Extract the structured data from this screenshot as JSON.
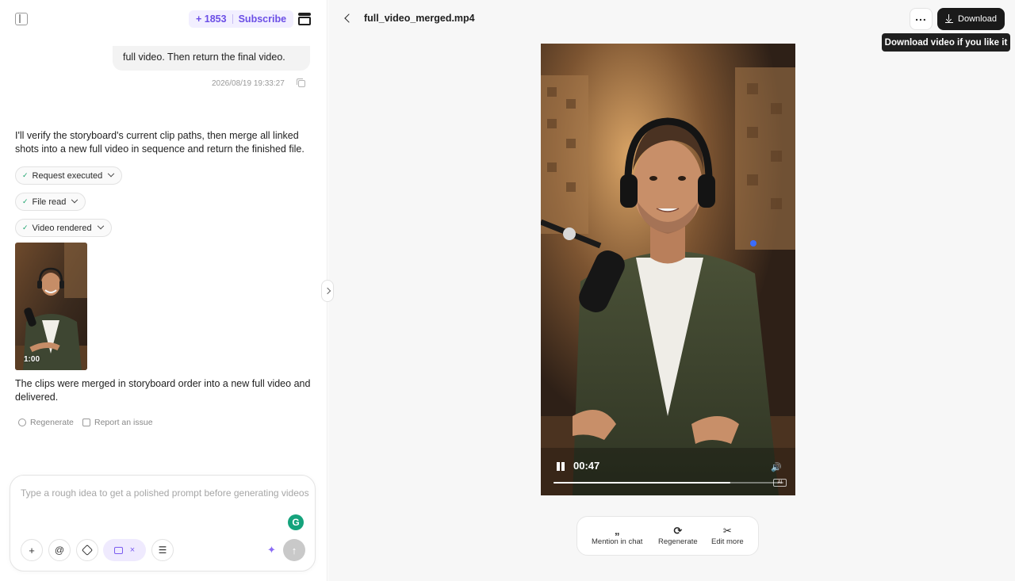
{
  "header": {
    "credits_value": "+ 1853",
    "subscribe_label": "Subscribe"
  },
  "chat": {
    "user_message": "full video. Then return the final video.",
    "user_timestamp": "2026/08/19 19:33:27",
    "ai_intro": "I'll verify the storyboard's current clip paths, then merge all linked shots into a new full video in sequence and return the finished file.",
    "steps": [
      {
        "label": "Request executed"
      },
      {
        "label": "File read"
      },
      {
        "label": "Video rendered"
      }
    ],
    "thumbnail_duration": "1:00",
    "ai_result": "The clips were merged in storyboard order into a new full video and delivered.",
    "actions": {
      "regenerate": "Regenerate",
      "report": "Report an issue"
    }
  },
  "composer": {
    "placeholder": "Type a rough idea to get a polished prompt before generating videos",
    "buttons": {
      "add": "+",
      "mention": "@",
      "video_mode_close": "×"
    }
  },
  "preview": {
    "file_name": "full_video_merged.mp4",
    "more_label": "...",
    "download_label": "Download",
    "tooltip": "Download video if you like it",
    "player": {
      "current_time": "00:47",
      "progress": 0.77,
      "ai_badge": "AI"
    },
    "tools": [
      {
        "icon": "quote-icon",
        "glyph": "„",
        "label": "Mention in chat"
      },
      {
        "icon": "refresh-icon",
        "glyph": "⟳",
        "label": "Regenerate"
      },
      {
        "icon": "scissors-icon",
        "glyph": "✂",
        "label": "Edit more"
      }
    ]
  },
  "colors": {
    "accent": "#6b4ee6",
    "download_bg": "#1a1a1a",
    "grammarly": "#15a37c"
  }
}
